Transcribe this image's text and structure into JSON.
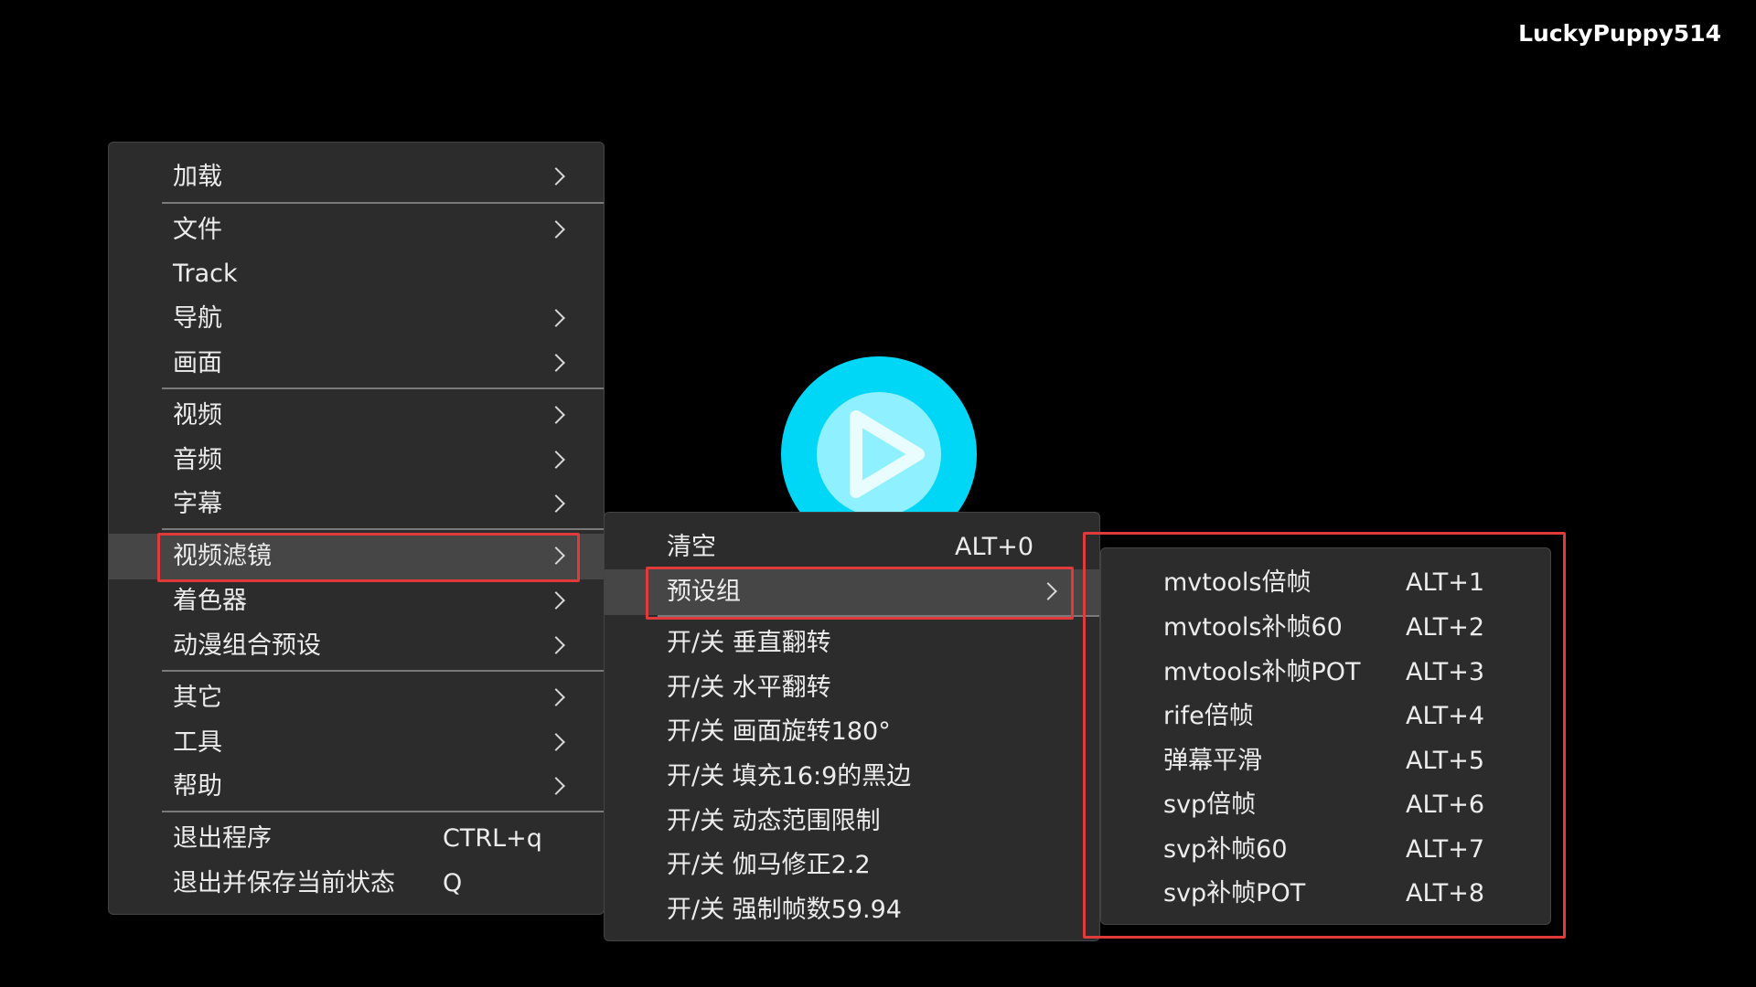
{
  "watermark": "LuckyPuppy514",
  "main_menu": {
    "items": [
      {
        "label": "加载",
        "submenu": true
      },
      {
        "label": "文件",
        "submenu": true
      },
      {
        "label": "Track",
        "submenu": false
      },
      {
        "label": "导航",
        "submenu": true
      },
      {
        "label": "画面",
        "submenu": true
      },
      {
        "label": "视频",
        "submenu": true
      },
      {
        "label": "音频",
        "submenu": true
      },
      {
        "label": "字幕",
        "submenu": true
      },
      {
        "label": "视频滤镜",
        "submenu": true
      },
      {
        "label": "着色器",
        "submenu": true
      },
      {
        "label": "动漫组合预设",
        "submenu": true
      },
      {
        "label": "其它",
        "submenu": true
      },
      {
        "label": "工具",
        "submenu": true
      },
      {
        "label": "帮助",
        "submenu": true
      },
      {
        "label": "退出程序",
        "shortcut": "CTRL+q"
      },
      {
        "label": "退出并保存当前状态",
        "shortcut": "Q"
      }
    ]
  },
  "filter_menu": {
    "items": [
      {
        "label": "清空",
        "shortcut": "ALT+0"
      },
      {
        "label": "预设组",
        "submenu": true
      },
      {
        "label": "开/关 垂直翻转"
      },
      {
        "label": "开/关 水平翻转"
      },
      {
        "label": "开/关 画面旋转180°"
      },
      {
        "label": "开/关 填充16:9的黑边"
      },
      {
        "label": "开/关 动态范围限制"
      },
      {
        "label": "开/关 伽马修正2.2"
      },
      {
        "label": "开/关 强制帧数59.94"
      }
    ]
  },
  "preset_menu": {
    "items": [
      {
        "label": "mvtools倍帧",
        "shortcut": "ALT+1"
      },
      {
        "label": "mvtools补帧60",
        "shortcut": "ALT+2"
      },
      {
        "label": "mvtools补帧POT",
        "shortcut": "ALT+3"
      },
      {
        "label": "rife倍帧",
        "shortcut": "ALT+4"
      },
      {
        "label": "弹幕平滑",
        "shortcut": "ALT+5"
      },
      {
        "label": "svp倍帧",
        "shortcut": "ALT+6"
      },
      {
        "label": "svp补帧60",
        "shortcut": "ALT+7"
      },
      {
        "label": "svp补帧POT",
        "shortcut": "ALT+8"
      }
    ]
  },
  "colors": {
    "menu_bg": "#2c2c2c",
    "highlight_border": "#e03a3a",
    "logo": "#00d4f5"
  },
  "icons": {
    "logo": "play-logo-icon",
    "submenu": "chevron-right-icon"
  }
}
